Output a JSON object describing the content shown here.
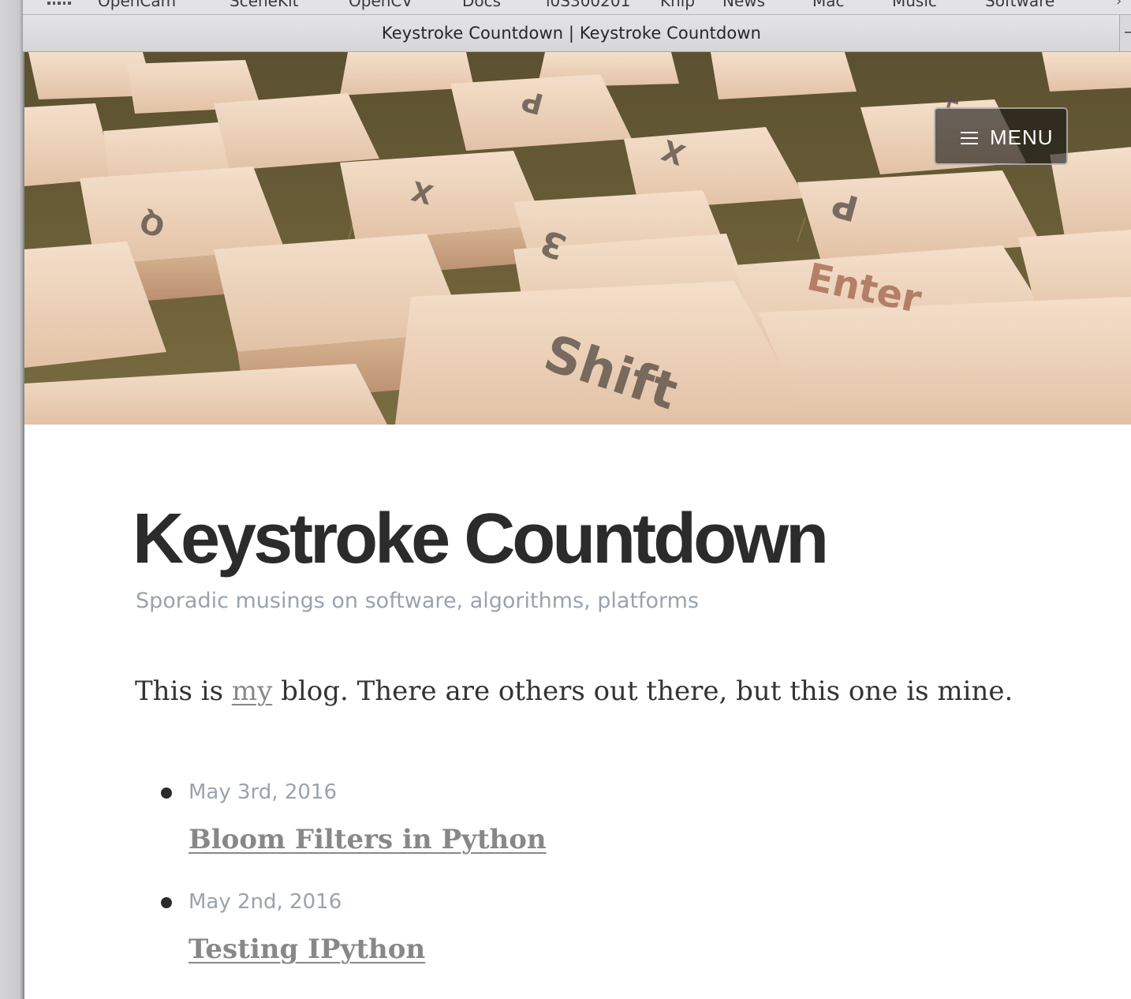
{
  "bookmarks_bar": {
    "items": [
      "OpenCam",
      "SceneKit",
      "OpenCV",
      "Docs",
      "i0S300201",
      "Knip",
      "News",
      "Mac",
      "Music",
      "Software"
    ]
  },
  "tab": {
    "title": "Keystroke Countdown | Keystroke Countdown"
  },
  "header": {
    "menu_label": "MENU"
  },
  "site": {
    "title": "Keystroke Countdown",
    "tagline": "Sporadic musings on software, algorithms, platforms"
  },
  "intro": {
    "before": "This is ",
    "link": "my",
    "after": " blog. There are others out there, but this one is mine."
  },
  "posts": [
    {
      "date": "May 3rd, 2016",
      "title": "Bloom Filters in Python"
    },
    {
      "date": "May 2nd, 2016",
      "title": "Testing IPython"
    }
  ],
  "colors": {
    "title": "#2b2b2b",
    "muted": "#9aa3ab",
    "link": "#888888"
  },
  "icons": [
    "grid-icon",
    "chevron-right-icon",
    "hamburger-icon"
  ]
}
